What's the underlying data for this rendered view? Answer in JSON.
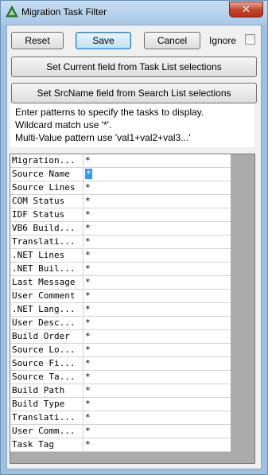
{
  "window": {
    "title": "Migration Task Filter",
    "close_glyph": "✕"
  },
  "buttons": {
    "reset": "Reset",
    "save": "Save",
    "cancel": "Cancel"
  },
  "ignore": {
    "label": "Ignore",
    "checked": false
  },
  "actions": {
    "set_current": "Set Current field from Task List selections",
    "set_srcname": "Set SrcName field from Search List selections"
  },
  "help_lines": [
    "Enter patterns to specify the tasks to display.",
    "Wildcard match use '*'.",
    "Multi-Value pattern use 'val1+val2+val3...'"
  ],
  "grid_rows": [
    {
      "name": "Migration...",
      "value": "*"
    },
    {
      "name": "Source Name",
      "value": "*",
      "selected": true
    },
    {
      "name": "Source Lines",
      "value": "*"
    },
    {
      "name": "COM Status",
      "value": "*"
    },
    {
      "name": "IDF Status",
      "value": "*"
    },
    {
      "name": "VB6 Build...",
      "value": "*"
    },
    {
      "name": "Translati...",
      "value": "*"
    },
    {
      "name": ".NET Lines",
      "value": "*"
    },
    {
      "name": ".NET Buil...",
      "value": "*"
    },
    {
      "name": "Last Message",
      "value": "*"
    },
    {
      "name": "User Comment",
      "value": "*"
    },
    {
      "name": ".NET Lang...",
      "value": "*"
    },
    {
      "name": "User Desc...",
      "value": "*"
    },
    {
      "name": "Build Order",
      "value": "*"
    },
    {
      "name": "Source Lo...",
      "value": "*"
    },
    {
      "name": "Source Fi...",
      "value": "*"
    },
    {
      "name": "Source Ta...",
      "value": "*"
    },
    {
      "name": "Build Path",
      "value": "*"
    },
    {
      "name": "Build Type",
      "value": "*"
    },
    {
      "name": "Translati...",
      "value": "*"
    },
    {
      "name": "User Comm...",
      "value": "*"
    },
    {
      "name": "Task Tag",
      "value": "*"
    }
  ],
  "colors": {
    "selection": "#3399ff",
    "title_bar": "#a9c8e6",
    "close_button": "#c7452f"
  }
}
